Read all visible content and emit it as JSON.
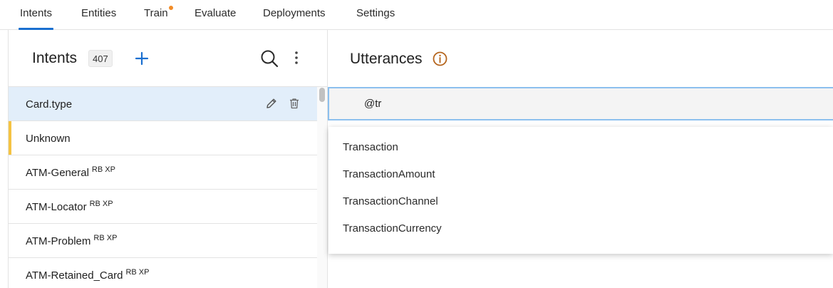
{
  "tabs": [
    {
      "label": "Intents",
      "active": true
    },
    {
      "label": "Entities",
      "active": false
    },
    {
      "label": "Train",
      "active": false,
      "has_notification_dot": true
    },
    {
      "label": "Evaluate",
      "active": false
    },
    {
      "label": "Deployments",
      "active": false
    },
    {
      "label": "Settings",
      "active": false
    }
  ],
  "intents_panel": {
    "title": "Intents",
    "count": "407",
    "items": [
      {
        "label": "Card.type",
        "tags": "",
        "selected": true
      },
      {
        "label": "Unknown",
        "tags": "",
        "flagged": true
      },
      {
        "label": "ATM-General",
        "tags": "RB XP"
      },
      {
        "label": "ATM-Locator",
        "tags": "RB XP"
      },
      {
        "label": "ATM-Problem",
        "tags": "RB XP"
      },
      {
        "label": "ATM-Retained_Card",
        "tags": "RB XP"
      }
    ]
  },
  "utterances_panel": {
    "title": "Utterances",
    "input_value": "@tr",
    "suggestions": [
      "Transaction",
      "TransactionAmount",
      "TransactionChannel",
      "TransactionCurrency"
    ]
  },
  "icons": {
    "add": "plus-icon",
    "search": "search-icon",
    "more": "more-vertical-icon",
    "edit": "pencil-icon",
    "delete": "trash-icon",
    "info": "info-circle-icon"
  },
  "colors": {
    "accent_blue": "#1a6fd0",
    "selected_row": "#e2eefa",
    "flag_yellow": "#f5c342",
    "notification_orange": "#f28c28",
    "info_icon": "#b5651d",
    "input_focus_border": "#8cc0ee"
  }
}
